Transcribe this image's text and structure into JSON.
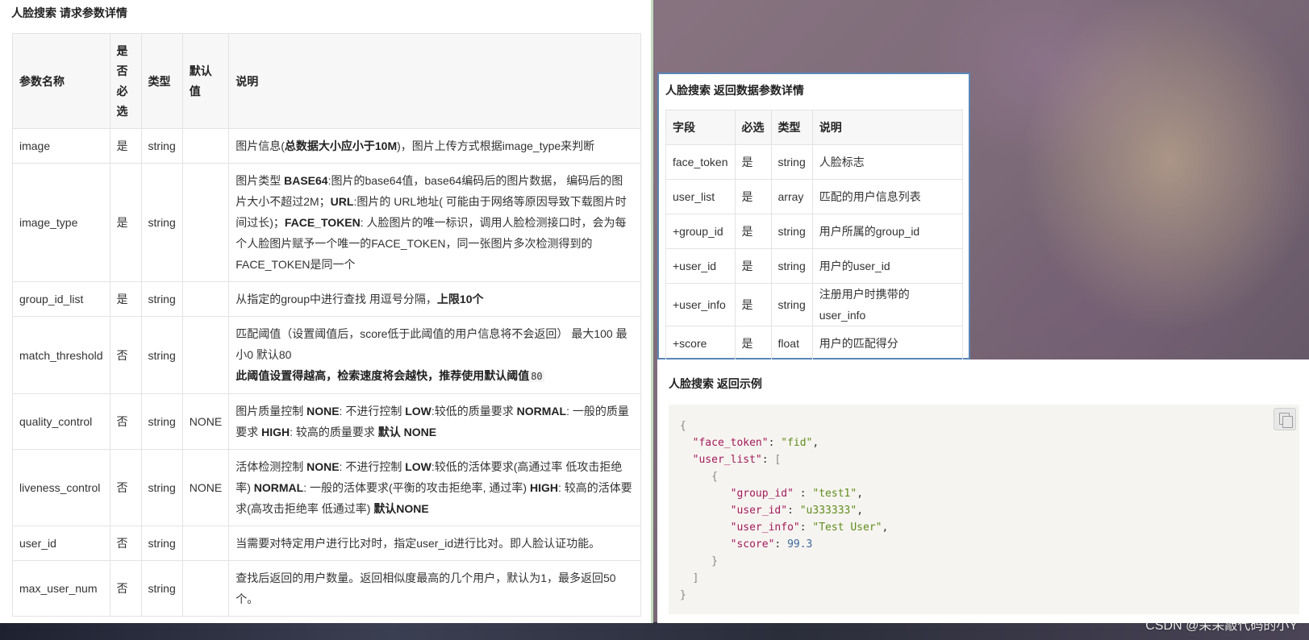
{
  "request": {
    "title": "人脸搜索 请求参数详情",
    "headers": [
      "参数名称",
      "是否必选",
      "类型",
      "默认值",
      "说明"
    ],
    "rows": [
      {
        "name": "image",
        "required": "是",
        "type": "string",
        "default": "",
        "desc_pre": "图片信息(",
        "desc_bold": "总数据大小应小于10M",
        "desc_post": ")，图片上传方式根据image_type来判断"
      },
      {
        "name": "image_type",
        "required": "是",
        "type": "string",
        "default": "",
        "desc_parts": [
          "图片类型 ",
          "BASE64",
          ":图片的base64值，base64编码后的图片数据， 编码后的图片大小不超过2M；",
          "URL",
          ":图片的 URL地址( 可能由于网络等原因导致下载图片时间过长)；",
          "FACE_TOKEN",
          ": 人脸图片的唯一标识，调用人脸检测接口时，会为每个人脸图片赋予一个唯一的FACE_TOKEN，同一张图片多次检测得到的FACE_TOKEN是同一个"
        ]
      },
      {
        "name": "group_id_list",
        "required": "是",
        "type": "string",
        "default": "",
        "desc_pre": "从指定的group中进行查找 用逗号分隔，",
        "desc_bold": "上限10个",
        "desc_post": ""
      },
      {
        "name": "match_threshold",
        "required": "否",
        "type": "string",
        "default": "",
        "desc_line1": "匹配阈值（设置阈值后，score低于此阈值的用户信息将不会返回） 最大100 最小0 默认80",
        "desc_bold": "此阈值设置得越高，检索速度将会越快，推荐使用默认阈值",
        "desc_code": "80"
      },
      {
        "name": "quality_control",
        "required": "否",
        "type": "string",
        "default": "NONE",
        "desc_parts": [
          "图片质量控制 ",
          "NONE",
          ": 不进行控制 ",
          "LOW",
          ":较低的质量要求 ",
          "NORMAL",
          ": 一般的质量要求 ",
          "HIGH",
          ": 较高的质量要求 ",
          "默认 NONE",
          ""
        ]
      },
      {
        "name": "liveness_control",
        "required": "否",
        "type": "string",
        "default": "NONE",
        "desc_parts": [
          "活体检测控制 ",
          "NONE",
          ": 不进行控制 ",
          "LOW",
          ":较低的活体要求(高通过率 低攻击拒绝率) ",
          "NORMAL",
          ": 一般的活体要求(平衡的攻击拒绝率, 通过率) ",
          "HIGH",
          ": 较高的活体要求(高攻击拒绝率 低通过率) ",
          "默认NONE",
          ""
        ]
      },
      {
        "name": "user_id",
        "required": "否",
        "type": "string",
        "default": "",
        "desc": "当需要对特定用户进行比对时，指定user_id进行比对。即人脸认证功能。"
      },
      {
        "name": "max_user_num",
        "required": "否",
        "type": "string",
        "default": "",
        "desc": "查找后返回的用户数量。返回相似度最高的几个用户，默认为1，最多返回50个。"
      }
    ]
  },
  "response": {
    "title": "人脸搜索 返回数据参数详情",
    "headers": [
      "字段",
      "必选",
      "类型",
      "说明"
    ],
    "rows": [
      [
        "face_token",
        "是",
        "string",
        "人脸标志"
      ],
      [
        "user_list",
        "是",
        "array",
        "匹配的用户信息列表"
      ],
      [
        "+group_id",
        "是",
        "string",
        "用户所属的group_id"
      ],
      [
        "+user_id",
        "是",
        "string",
        "用户的user_id"
      ],
      [
        "+user_info",
        "是",
        "string",
        "注册用户时携带的user_info"
      ],
      [
        "+score",
        "是",
        "float",
        "用户的匹配得分"
      ]
    ]
  },
  "example": {
    "title": "人脸搜索 返回示例",
    "code": {
      "open": "{",
      "k_face_token": "\"face_token\"",
      "v_face_token": "\"fid\"",
      "k_user_list": "\"user_list\"",
      "arr_open": "[",
      "obj_open": "{",
      "k_group_id": "\"group_id\"",
      "v_group_id": "\"test1\"",
      "k_user_id": "\"user_id\"",
      "v_user_id": "\"u333333\"",
      "k_user_info": "\"user_info\"",
      "v_user_info": "\"Test User\"",
      "k_score": "\"score\"",
      "v_score": "99.3",
      "obj_close": "}",
      "arr_close": "]",
      "close": "}"
    }
  },
  "watermark": "CSDN @呆呆敲代码的小Y"
}
